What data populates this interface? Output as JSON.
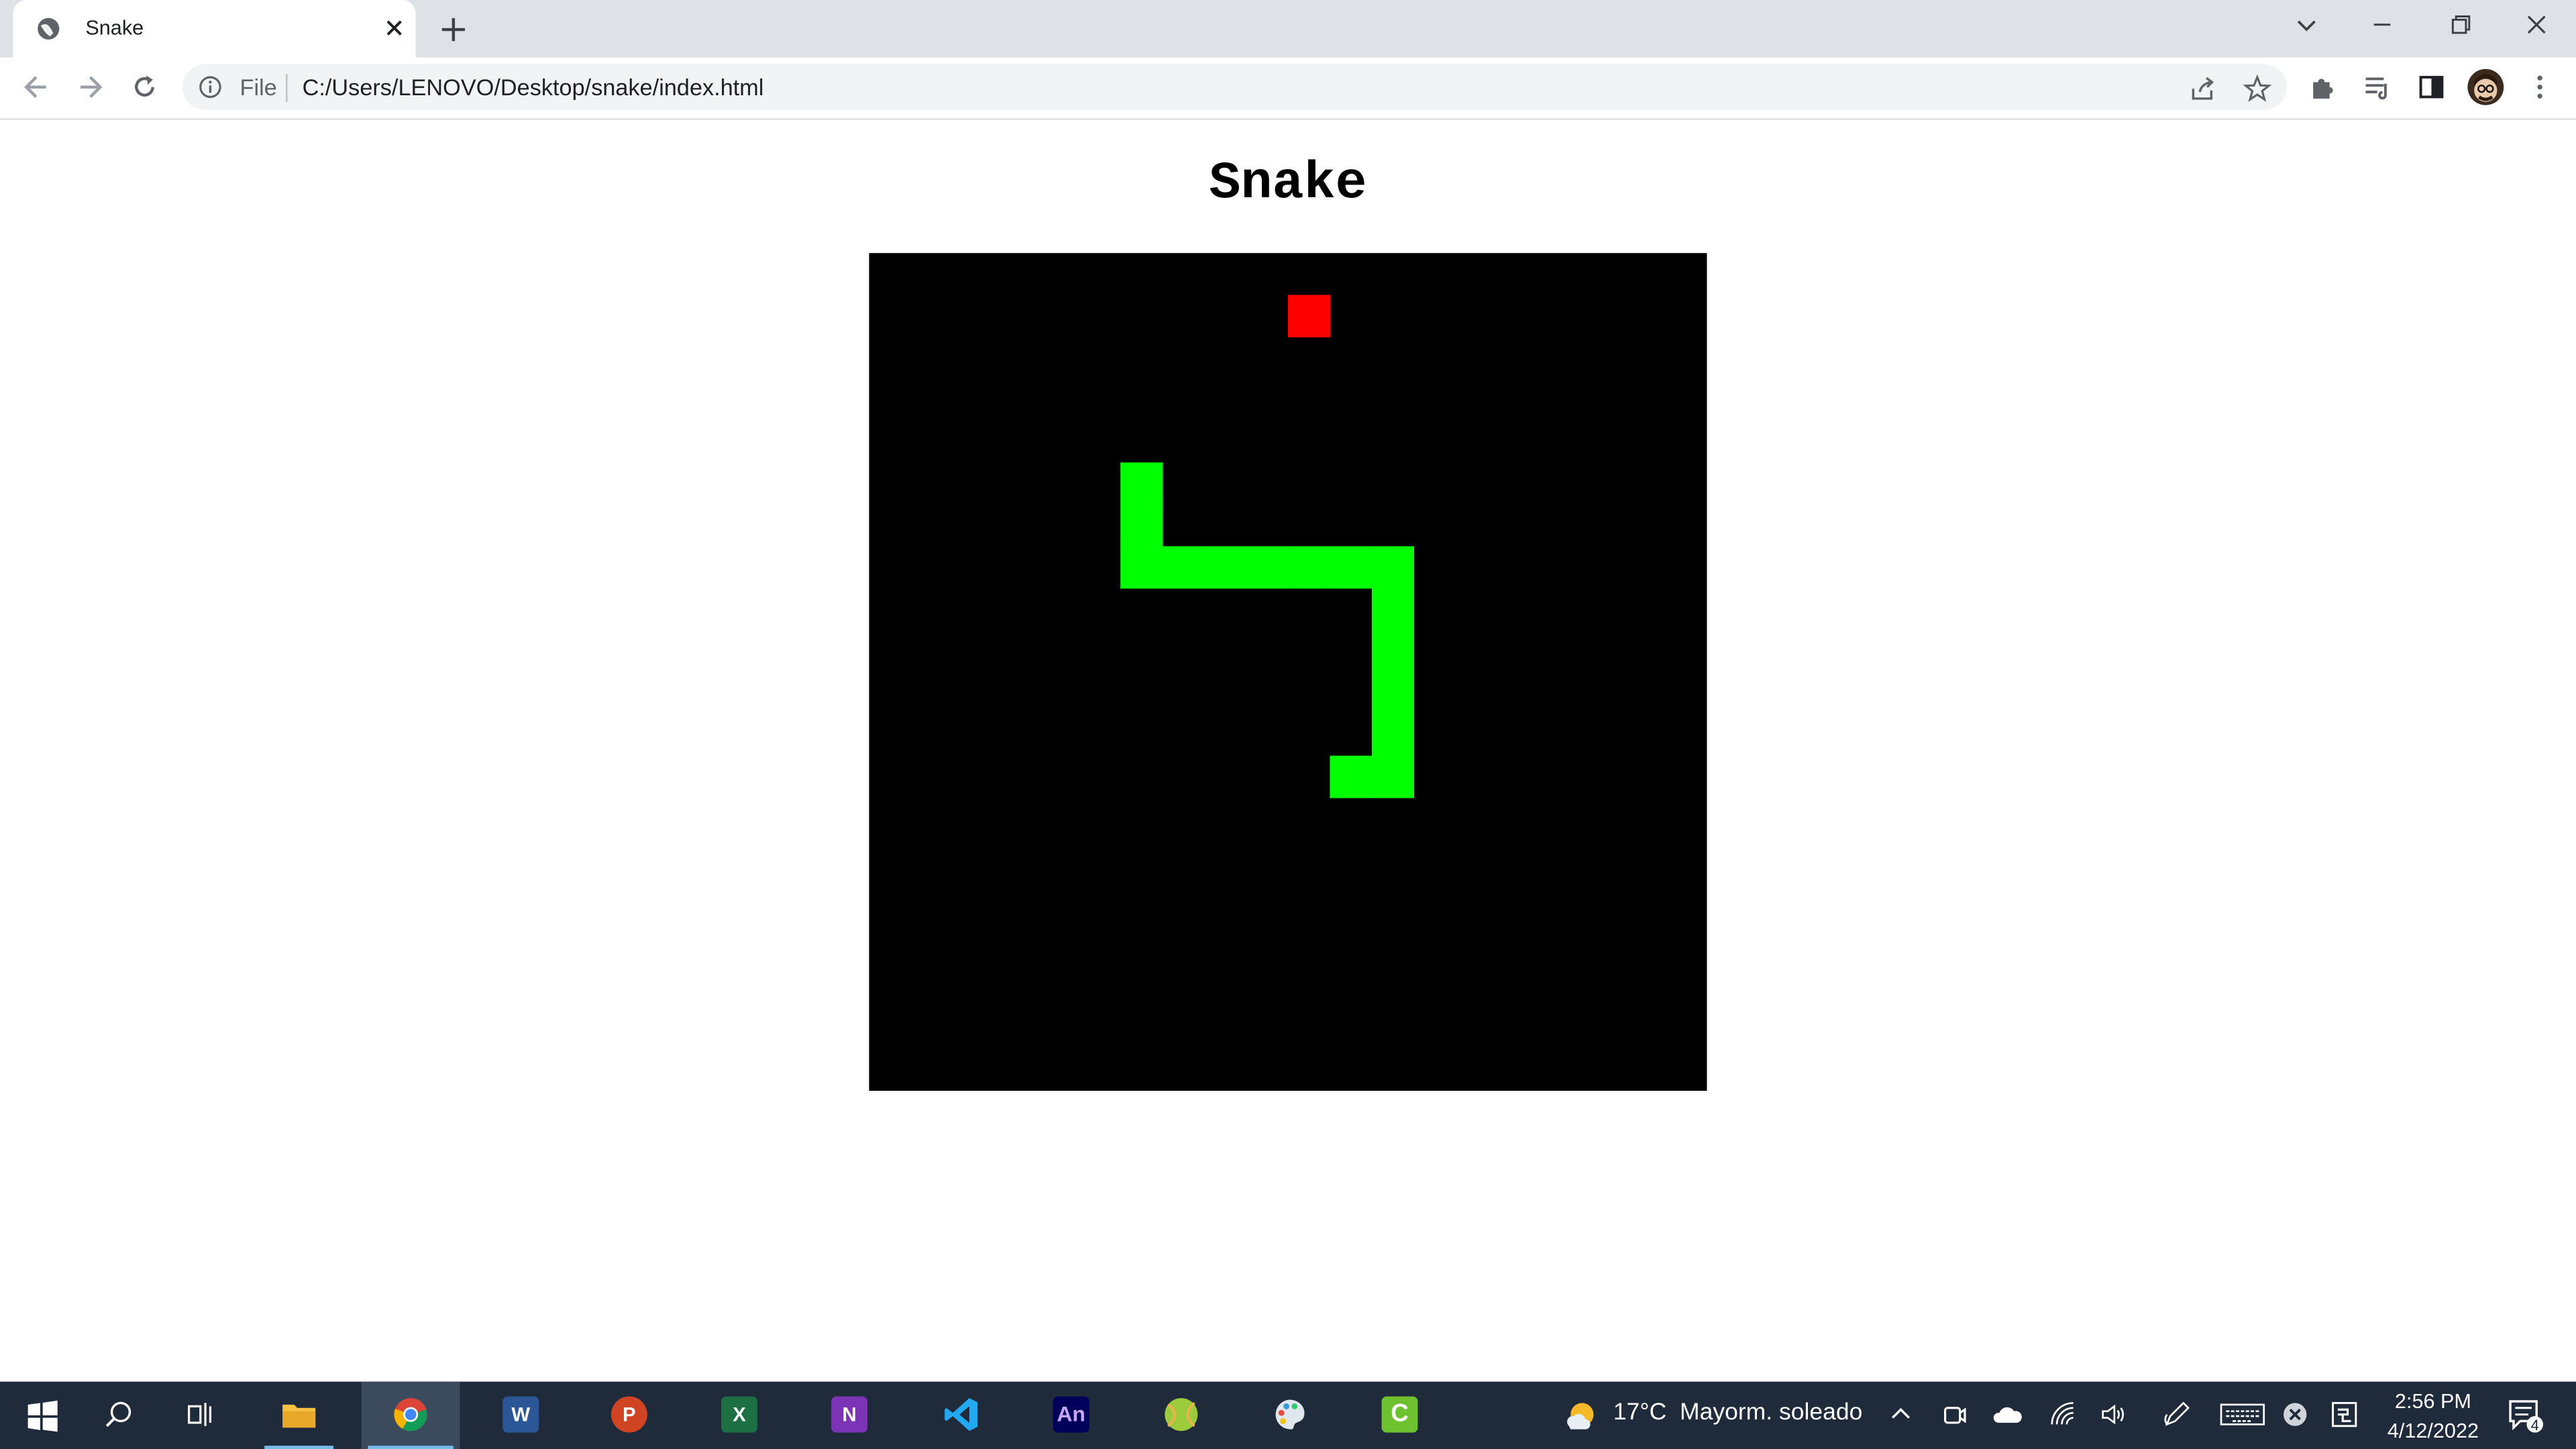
{
  "browser": {
    "tab": {
      "title": "Snake"
    },
    "address": {
      "scheme_label": "File",
      "url": "C:/Users/LENOVO/Desktop/snake/index.html"
    }
  },
  "page": {
    "title": "Snake",
    "game": {
      "grid_cells": 20,
      "background": "#000000",
      "snake_color": "#00ff00",
      "food_color": "#ff0000",
      "food": [
        10,
        1
      ],
      "snake": [
        [
          11,
          12
        ],
        [
          12,
          12
        ],
        [
          12,
          11
        ],
        [
          12,
          10
        ],
        [
          12,
          9
        ],
        [
          12,
          8
        ],
        [
          12,
          7
        ],
        [
          11,
          7
        ],
        [
          10,
          7
        ],
        [
          9,
          7
        ],
        [
          8,
          7
        ],
        [
          7,
          7
        ],
        [
          6,
          7
        ],
        [
          6,
          6
        ],
        [
          6,
          5
        ]
      ]
    }
  },
  "taskbar": {
    "weather": {
      "temp": "17°C",
      "condition": "Mayorm. soleado"
    },
    "clock": {
      "time": "2:56 PM",
      "date": "4/12/2022"
    },
    "notifications": "4",
    "apps": [
      {
        "name": "file-explorer",
        "label": ""
      },
      {
        "name": "chrome",
        "label": ""
      },
      {
        "name": "word",
        "label": "W"
      },
      {
        "name": "powerpoint",
        "label": "P"
      },
      {
        "name": "excel",
        "label": "X"
      },
      {
        "name": "onenote",
        "label": "N"
      },
      {
        "name": "vscode",
        "label": ""
      },
      {
        "name": "animate",
        "label": "An"
      },
      {
        "name": "tennis-ball-app",
        "label": ""
      },
      {
        "name": "paint-app",
        "label": ""
      },
      {
        "name": "camtasia",
        "label": "C"
      }
    ]
  }
}
